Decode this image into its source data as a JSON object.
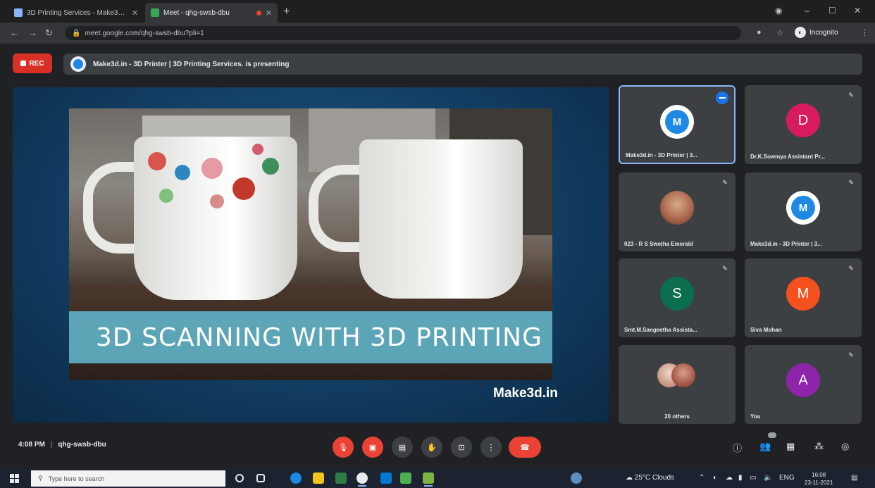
{
  "browser": {
    "tabs": [
      {
        "label": "3D Printing Services - Make3d.in"
      },
      {
        "label": "Meet - qhg-swsb-dbu"
      }
    ],
    "url": "meet.google.com/qhg-swsb-dbu?pli=1",
    "profile_label": "Incognito"
  },
  "meet": {
    "rec_label": "REC",
    "presenting_text": "Make3d.in - 3D Printer | 3D Printing Services. is presenting",
    "time": "4:08 PM",
    "separator": "|",
    "code": "qhg-swsb-dbu"
  },
  "slide": {
    "title": "3D SCANNING WITH 3D PRINTING",
    "watermark": "Make3d.in"
  },
  "participants": [
    {
      "name": "Make3d.in - 3D Printer | 3..."
    },
    {
      "initial": "D",
      "name": "Dr.K.Sowmya Assistant Pr..."
    },
    {
      "name": "023 - R S Swetha Emerald"
    },
    {
      "name": "Make3d.in - 3D Printer | 3..."
    },
    {
      "initial": "S",
      "name": "Smt.M.Sangeetha Assista..."
    },
    {
      "initial": "M",
      "name": "Siva Mohan"
    },
    {
      "name": "20 others"
    },
    {
      "initial": "A",
      "name": "You"
    }
  ],
  "taskbar": {
    "search_placeholder": "Type here to search",
    "weather": "25°C Clouds",
    "language": "ENG",
    "time": "16:08",
    "date": "23-11-2021"
  },
  "colors": {
    "accent": "#8ab4f8",
    "danger": "#ea4335",
    "surface": "#3c4043",
    "background": "#202124"
  }
}
